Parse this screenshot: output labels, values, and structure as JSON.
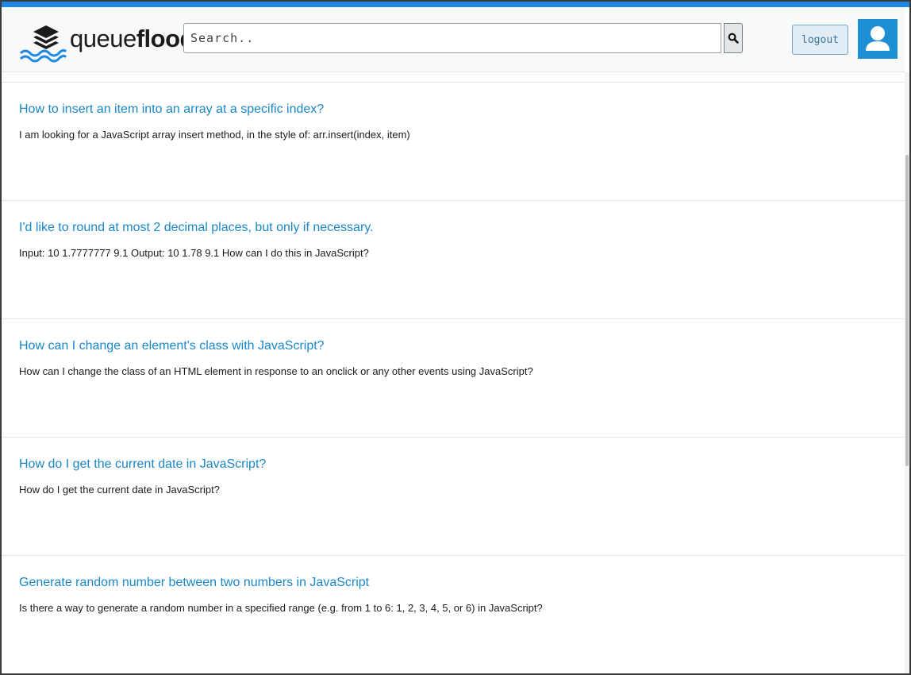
{
  "app": {
    "logo_text_light": "queue",
    "logo_text_bold": "flood",
    "accent_color": "#1e88e5",
    "logo_icon": "stacked-layers-with-waves-icon"
  },
  "header": {
    "search": {
      "placeholder": "Search..",
      "value": ""
    },
    "search_button_icon": "search-icon",
    "logout_label": "logout",
    "avatar_icon": "user-avatar-icon"
  },
  "questions": [
    {
      "title": "How to insert an item into an array at a specific index?",
      "body": "I am looking for a JavaScript array insert method, in the style of: arr.insert(index, item)"
    },
    {
      "title": "I'd like to round at most 2 decimal places, but only if necessary.",
      "body": "Input: 10 1.7777777 9.1 Output: 10 1.78 9.1 How can I do this in JavaScript?"
    },
    {
      "title": "How can I change an element's class with JavaScript?",
      "body": "How can I change the class of an HTML element in response to an onclick or any other events using JavaScript?"
    },
    {
      "title": "How do I get the current date in JavaScript?",
      "body": "How do I get the current date in JavaScript?"
    },
    {
      "title": "Generate random number between two numbers in JavaScript",
      "body": "Is there a way to generate a random number in a specified range (e.g. from 1 to 6: 1, 2, 3, 4, 5, or 6) in JavaScript?"
    }
  ]
}
